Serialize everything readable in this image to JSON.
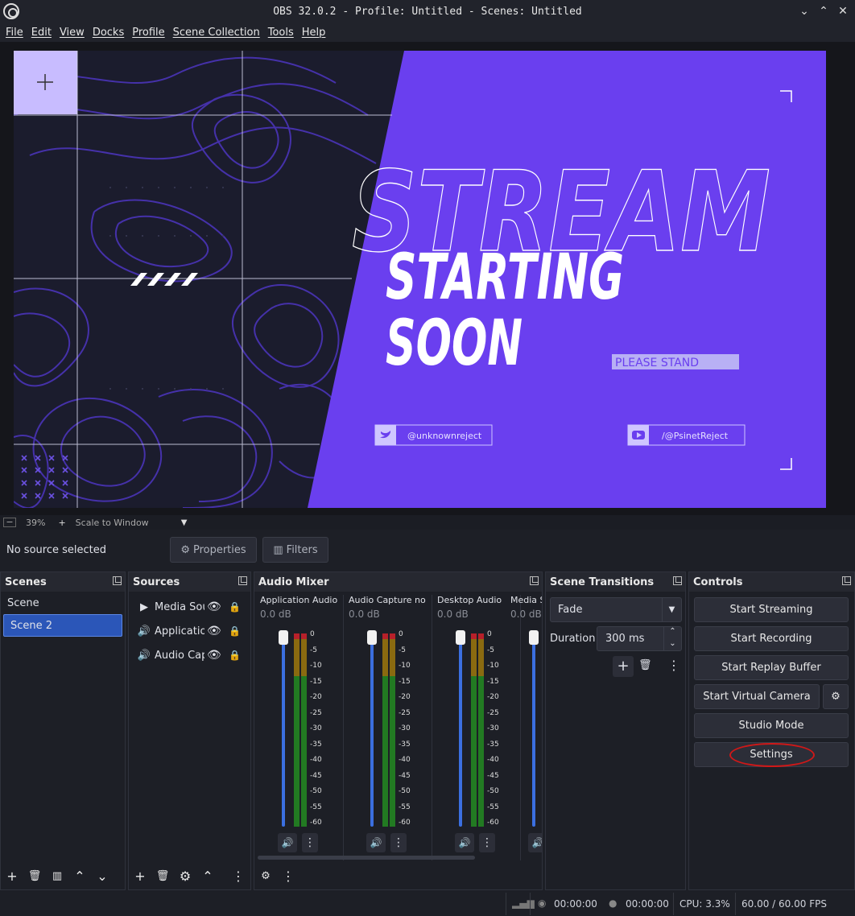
{
  "window": {
    "title": "OBS 32.0.2 - Profile: Untitled - Scenes: Untitled"
  },
  "menu": [
    "File",
    "Edit",
    "View",
    "Docks",
    "Profile",
    "Scene Collection",
    "Tools",
    "Help"
  ],
  "preview": {
    "headline1": "STREAM",
    "headline2": "STARTING",
    "headline3": "SOON",
    "stand_text": "PLEASE STAND",
    "twitter_handle": "@unknownreject",
    "youtube_handle": "/@PsinetReject"
  },
  "zoom": {
    "minus": "−",
    "level": "39%",
    "plus": "+",
    "mode": "Scale to Window"
  },
  "source_bar": {
    "status": "No source selected",
    "properties": "Properties",
    "filters": "Filters"
  },
  "scenes": {
    "title": "Scenes",
    "items": [
      "Scene",
      "Scene 2"
    ],
    "selected_index": 1
  },
  "sources": {
    "title": "Sources",
    "items": [
      {
        "name": "Media Sou",
        "icon": "play-icon"
      },
      {
        "name": "Applicatio",
        "icon": "speaker-icon"
      },
      {
        "name": "Audio Cap",
        "icon": "speaker-icon"
      }
    ]
  },
  "audio_mixer": {
    "title": "Audio Mixer",
    "channels": [
      {
        "name": "Application Audio C",
        "db": "0.0 dB"
      },
      {
        "name": "Audio Capture no D",
        "db": "0.0 dB"
      },
      {
        "name": "Desktop Audio",
        "db": "0.0 dB"
      },
      {
        "name": "Media S",
        "db": "0.0 dB"
      }
    ],
    "scale": [
      "0",
      "-5",
      "-10",
      "-15",
      "-20",
      "-25",
      "-30",
      "-35",
      "-40",
      "-45",
      "-50",
      "-55",
      "-60"
    ]
  },
  "transitions": {
    "title": "Scene Transitions",
    "selected": "Fade",
    "duration_label": "Duration",
    "duration_value": "300 ms"
  },
  "controls": {
    "title": "Controls",
    "buttons": [
      "Start Streaming",
      "Start Recording",
      "Start Replay Buffer",
      "Start Virtual Camera",
      "Studio Mode",
      "Settings"
    ]
  },
  "status": {
    "stream_time": "00:00:00",
    "rec_time": "00:00:00",
    "cpu": "CPU: 3.3%",
    "fps": "60.00 / 60.00 FPS"
  },
  "colors": {
    "accent_purple": "#6a3fef",
    "selection_blue": "#2b56b8",
    "highlight_red": "#d01818"
  }
}
